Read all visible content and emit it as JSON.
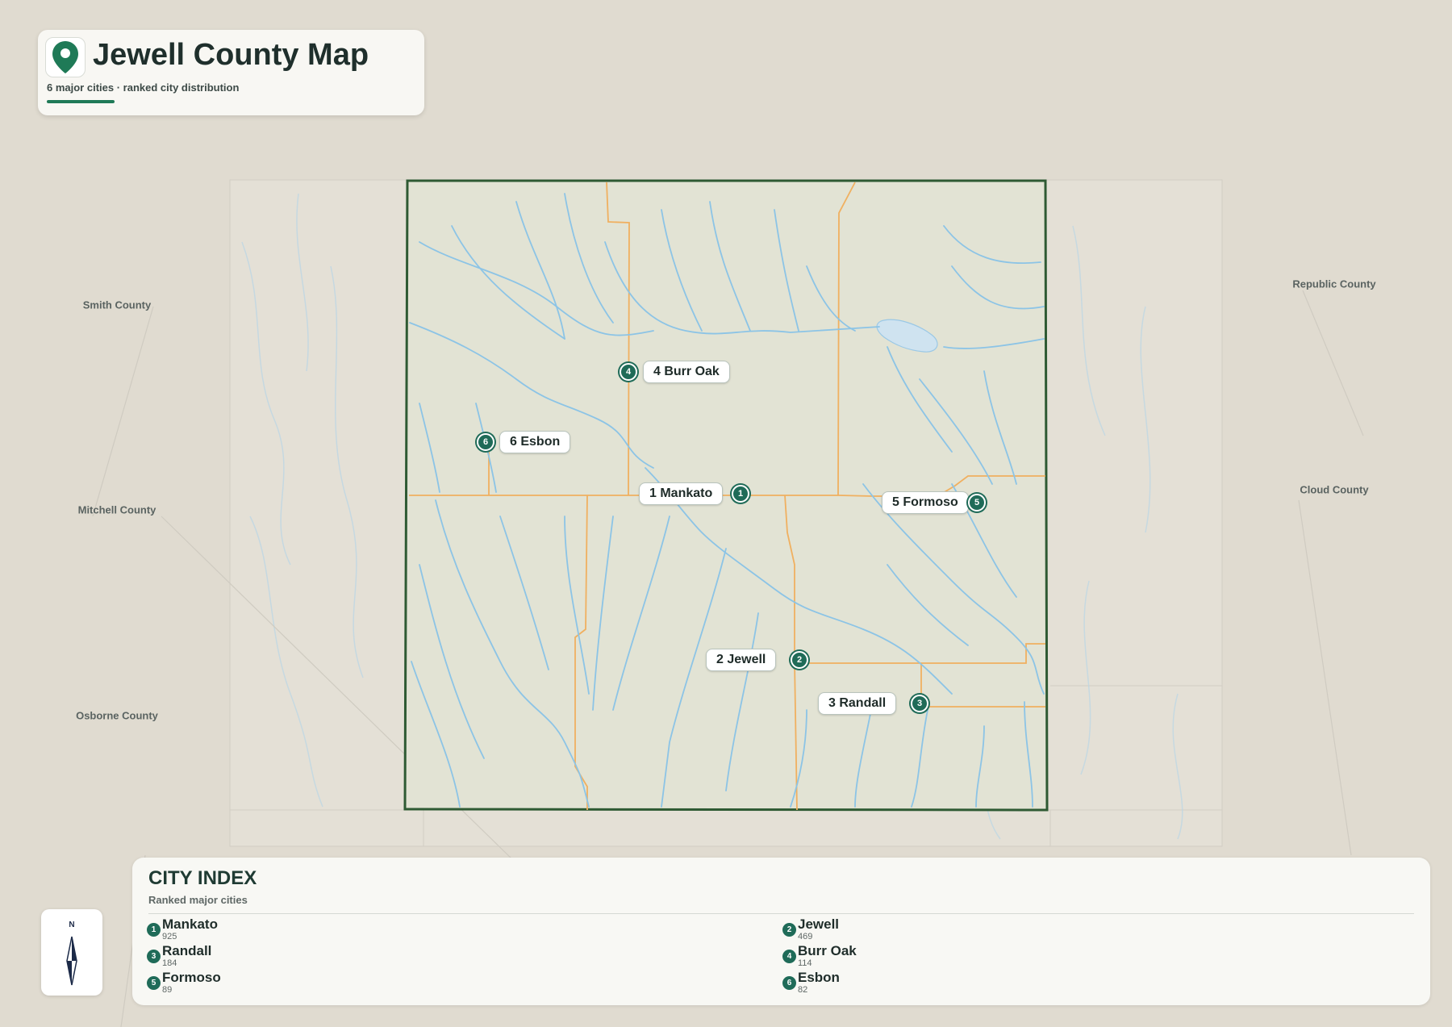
{
  "header": {
    "title": "Jewell County Map",
    "subtitle": "6 major cities · ranked city distribution",
    "icon": "map-pin-icon"
  },
  "neighbors": [
    {
      "name": "Smith County"
    },
    {
      "name": "Mitchell County"
    },
    {
      "name": "Osborne County"
    },
    {
      "name": "Republic County"
    },
    {
      "name": "Cloud County"
    }
  ],
  "cities": [
    {
      "rank": "1",
      "name": "Mankato",
      "label": "1 Mankato",
      "population": "925"
    },
    {
      "rank": "2",
      "name": "Jewell",
      "label": "2 Jewell",
      "population": "469"
    },
    {
      "rank": "3",
      "name": "Randall",
      "label": "3 Randall",
      "population": "184"
    },
    {
      "rank": "4",
      "name": "Burr Oak",
      "label": "4 Burr Oak",
      "population": "114"
    },
    {
      "rank": "5",
      "name": "Formoso",
      "label": "5 Formoso",
      "population": "89"
    },
    {
      "rank": "6",
      "name": "Esbon",
      "label": "6 Esbon",
      "population": "82"
    }
  ],
  "index": {
    "title": "CITY INDEX",
    "subtitle": "Ranked major cities"
  },
  "compass": {
    "north_label": "N",
    "icon": "compass-arrow-icon"
  },
  "colors": {
    "accent": "#1f7a57",
    "marker": "#1f6b58",
    "county_border": "#2e5a33",
    "county_fill": "#e2e3d4",
    "water": "#8cc4e6",
    "roads": "#f0b060",
    "background": "#e0dbd0"
  }
}
